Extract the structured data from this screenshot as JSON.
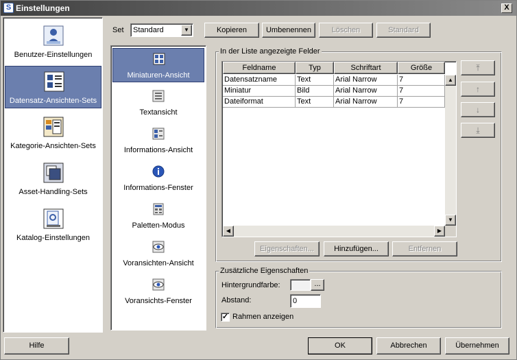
{
  "window": {
    "title": "Einstellungen",
    "close_label": "X",
    "app_icon_glyph": "S"
  },
  "sidebar": {
    "items": [
      {
        "label": "Benutzer-Einstellungen",
        "icon": "user-settings-icon"
      },
      {
        "label": "Datensatz-Ansichten-Sets",
        "icon": "record-view-sets-icon",
        "selected": true
      },
      {
        "label": "Kategorie-Ansichten-Sets",
        "icon": "category-view-sets-icon"
      },
      {
        "label": "Asset-Handling-Sets",
        "icon": "asset-handling-sets-icon"
      },
      {
        "label": "Katalog-Einstellungen",
        "icon": "catalog-settings-icon"
      }
    ]
  },
  "set_bar": {
    "label": "Set",
    "selected": "Standard",
    "copy_label": "Kopieren",
    "rename_label": "Umbenennen",
    "delete_label": "Löschen",
    "default_label": "Standard"
  },
  "views": {
    "items": [
      {
        "label": "Miniaturen-Ansicht",
        "icon": "thumbnail-view-icon",
        "selected": true
      },
      {
        "label": "Textansicht",
        "icon": "text-view-icon"
      },
      {
        "label": "Informations-Ansicht",
        "icon": "info-view-icon"
      },
      {
        "label": "Informations-Fenster",
        "icon": "info-window-icon"
      },
      {
        "label": "Paletten-Modus",
        "icon": "palette-mode-icon"
      },
      {
        "label": "Voransichten-Ansicht",
        "icon": "preview-view-icon"
      },
      {
        "label": "Voransichts-Fenster",
        "icon": "preview-window-icon"
      }
    ]
  },
  "fields": {
    "group_label": "In der Liste angezeigte Felder",
    "columns": [
      "Feldname",
      "Typ",
      "Schriftart",
      "Größe"
    ],
    "rows": [
      [
        "Datensatzname",
        "Text",
        "Arial Narrow",
        "7"
      ],
      [
        "Miniatur",
        "Bild",
        "Arial Narrow",
        "7"
      ],
      [
        "Dateiformat",
        "Text",
        "Arial Narrow",
        "7"
      ]
    ],
    "properties_label": "Eigenschaften...",
    "add_label": "Hinzufügen...",
    "remove_label": "Entfernen"
  },
  "extra": {
    "group_label": "Zusätzliche Eigenschaften",
    "bg_color_label": "Hintergrundfarbe:",
    "bg_color_value": "#f2f2f2",
    "picker_label": "...",
    "spacing_label": "Abstand:",
    "spacing_value": "0",
    "frame_label": "Rahmen anzeigen",
    "frame_checked": true,
    "check_glyph": "✓"
  },
  "footer": {
    "help_label": "Hilfe",
    "ok_label": "OK",
    "cancel_label": "Abbrechen",
    "apply_label": "Übernehmen"
  },
  "colors": {
    "selection": "#6b7fae",
    "titlebar_start": "#404040"
  },
  "glyphs": {
    "up": "▲",
    "down": "▼",
    "left": "◀",
    "right": "▶",
    "dropdown": "▼",
    "move_top": "⤒",
    "move_up": "↑",
    "move_down": "↓",
    "move_bottom": "⤓"
  }
}
